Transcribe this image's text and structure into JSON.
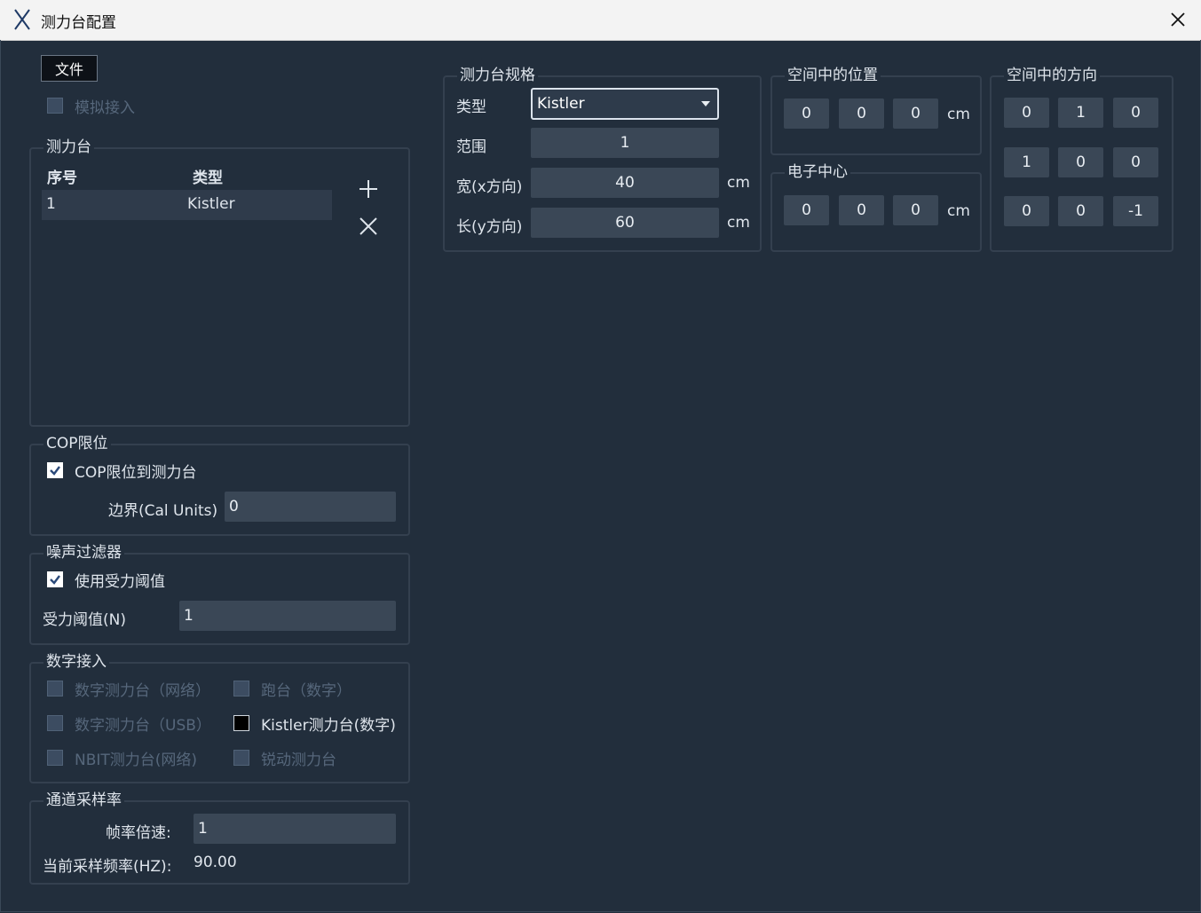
{
  "window": {
    "title": "测力台配置"
  },
  "file_button": "文件",
  "simulate": {
    "label": "模拟接入",
    "checked": false
  },
  "platforms": {
    "legend": "测力台",
    "columns": [
      "序号",
      "类型"
    ],
    "rows": [
      {
        "index": "1",
        "type": "Kistler"
      }
    ]
  },
  "cop": {
    "legend": "COP限位",
    "checkbox_label": "COP限位到测力台",
    "boundary_label": "边界(Cal Units)",
    "boundary_value": "0"
  },
  "noise": {
    "legend": "噪声过滤器",
    "checkbox_label": "使用受力阈值",
    "threshold_label": "受力阈值(N)",
    "threshold_value": "1"
  },
  "digital": {
    "legend": "数字接入",
    "options": {
      "net": "数字测力台（网络）",
      "treadmill": "跑台（数字）",
      "usb": "数字测力台（USB）",
      "kistler": "Kistler测力台(数字)",
      "nbit": "NBIT测力台(网络)",
      "ruidong": "锐动测力台"
    }
  },
  "channel": {
    "legend": "通道采样率",
    "frame_label": "帧率倍速:",
    "frame_value": "1",
    "freq_label": "当前采样频率(HZ):",
    "freq_value": "90.00"
  },
  "spec": {
    "legend": "测力台规格",
    "type_label": "类型",
    "type_value": "Kistler",
    "range_label": "范围",
    "range_value": "1",
    "width_label": "宽(x方向)",
    "width_value": "40",
    "length_label": "长(y方向)",
    "length_value": "60",
    "unit": "cm"
  },
  "position": {
    "legend": "空间中的位置",
    "values": [
      "0",
      "0",
      "0"
    ],
    "unit": "cm"
  },
  "center": {
    "legend": "电子中心",
    "values": [
      "0",
      "0",
      "0"
    ],
    "unit": "cm"
  },
  "direction": {
    "legend": "空间中的方向",
    "matrix": [
      [
        "0",
        "1",
        "0"
      ],
      [
        "1",
        "0",
        "0"
      ],
      [
        "0",
        "0",
        "-1"
      ]
    ]
  },
  "colors": {
    "background": "#222e3c",
    "field": "#3a4756",
    "border": "#34404f"
  }
}
